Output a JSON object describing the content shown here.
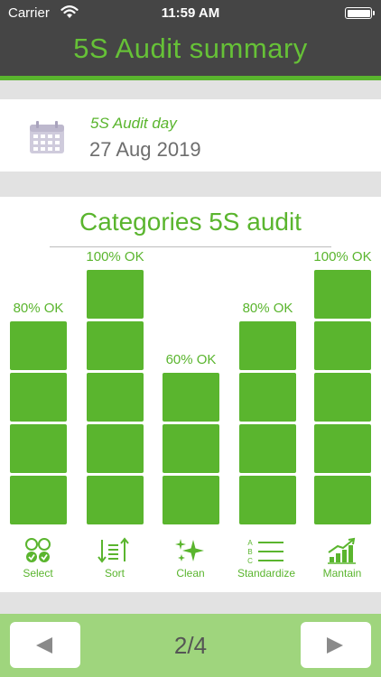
{
  "status_bar": {
    "carrier": "Carrier",
    "time": "11:59 AM"
  },
  "header": {
    "title": "5S Audit summary"
  },
  "audit_day": {
    "label": "5S Audit day",
    "date": "27 Aug 2019"
  },
  "chart_title": "Categories 5S audit",
  "chart_data": {
    "type": "bar",
    "title": "Categories 5S audit",
    "categories": [
      "Select",
      "Sort",
      "Clean",
      "Standardize",
      "Mantain"
    ],
    "values": [
      80,
      100,
      60,
      80,
      100
    ],
    "data_labels": [
      "80% OK",
      "100% OK",
      "60% OK",
      "80% OK",
      "100% OK"
    ],
    "unit": "% OK",
    "ylim": [
      0,
      100
    ],
    "blocks_per_100": 5,
    "color": "#5ab52e"
  },
  "category_icons": [
    "select-icon",
    "sort-icon",
    "clean-icon",
    "standardize-icon",
    "maintain-icon"
  ],
  "footer": {
    "page_indicator": "2/4"
  },
  "colors": {
    "accent": "#5ab52e",
    "header_bg": "#454545",
    "footer_bg": "#9fd57d"
  }
}
